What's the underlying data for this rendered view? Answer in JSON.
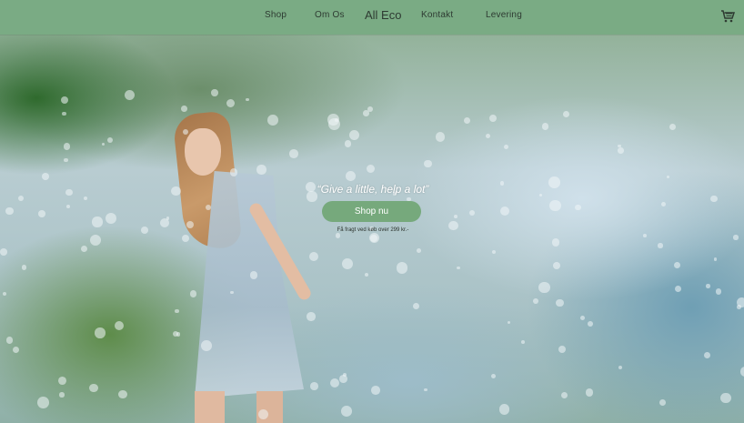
{
  "nav": {
    "items": [
      {
        "label": "Shop"
      },
      {
        "label": "Om Os"
      },
      {
        "label": "Kontakt"
      },
      {
        "label": "Levering"
      }
    ],
    "brand": "All Eco",
    "cart_icon": "shopping-cart-icon"
  },
  "hero": {
    "quote": "“Give a little, help a lot”",
    "cta_label": "Shop nu",
    "note": "Få fragt ved køb over 299 kr.-"
  },
  "colors": {
    "nav_bg": "#7aab84",
    "cta_bg": "#76a97c",
    "text_dark": "#2e3b32"
  }
}
